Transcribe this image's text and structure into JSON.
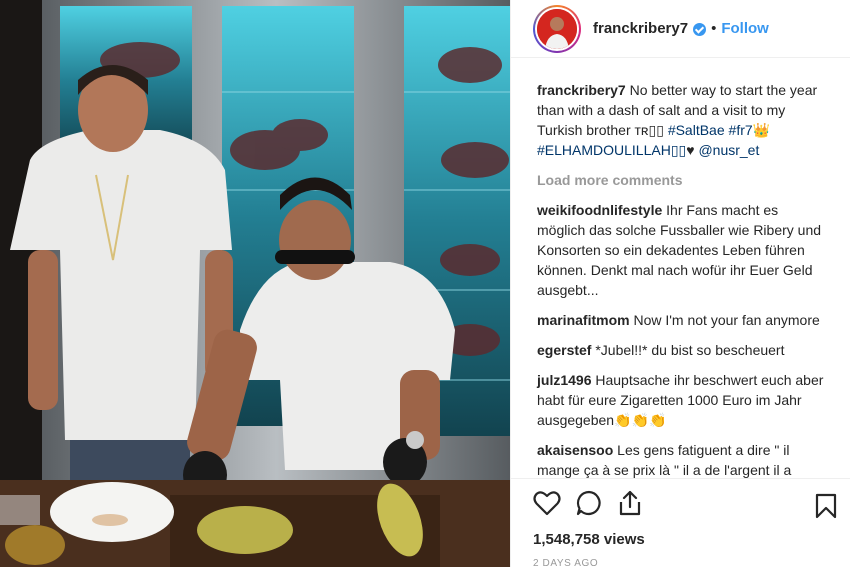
{
  "post": {
    "media_alt": "Video of two men carving meat at a restaurant",
    "header": {
      "username": "franckribery7",
      "verified_icon": "verified-badge-icon",
      "separator": "•",
      "follow_label": "Follow"
    },
    "caption": {
      "username": "franckribery7",
      "text": "No better way to start the year than with a dash of salt and a visit to my Turkish brother ᴛʀ▯▯ ",
      "tag1": "#SaltBae",
      "tag2": "#fr7",
      "text2": "👑",
      "tag3": "#ELHAMDOULILLAH▯▯",
      "text3": "♥ ",
      "mention": "@nusr_et"
    },
    "load_more": "Load more comments",
    "comments": [
      {
        "user": "weikifoodnlifestyle",
        "text": "Ihr Fans macht es möglich das solche Fussballer wie Ribery und Konsorten so ein dekadentes Leben führen können. Denkt mal nach wofür ihr Euer Geld ausgebt..."
      },
      {
        "user": "marinafitmom",
        "text": "Now I'm not your fan anymore"
      },
      {
        "user": "egerstef",
        "text": "*Jubel!!* du bist so bescheuert"
      },
      {
        "user": "julz1496",
        "text": "Hauptsache ihr beschwert euch aber habt für eure Zigaretten 1000 Euro im Jahr ausgegeben👏👏👏"
      },
      {
        "user": "akaisensoo",
        "text": "Les gens fatiguent a dire \" il mange ça à se prix là \" il a de l'argent il a"
      }
    ],
    "actions": {
      "like_icon": "heart-icon",
      "comment_icon": "comment-icon",
      "share_icon": "share-icon",
      "save_icon": "bookmark-icon"
    },
    "views": "1,548,758 views",
    "time_ago": "2 DAYS AGO"
  }
}
